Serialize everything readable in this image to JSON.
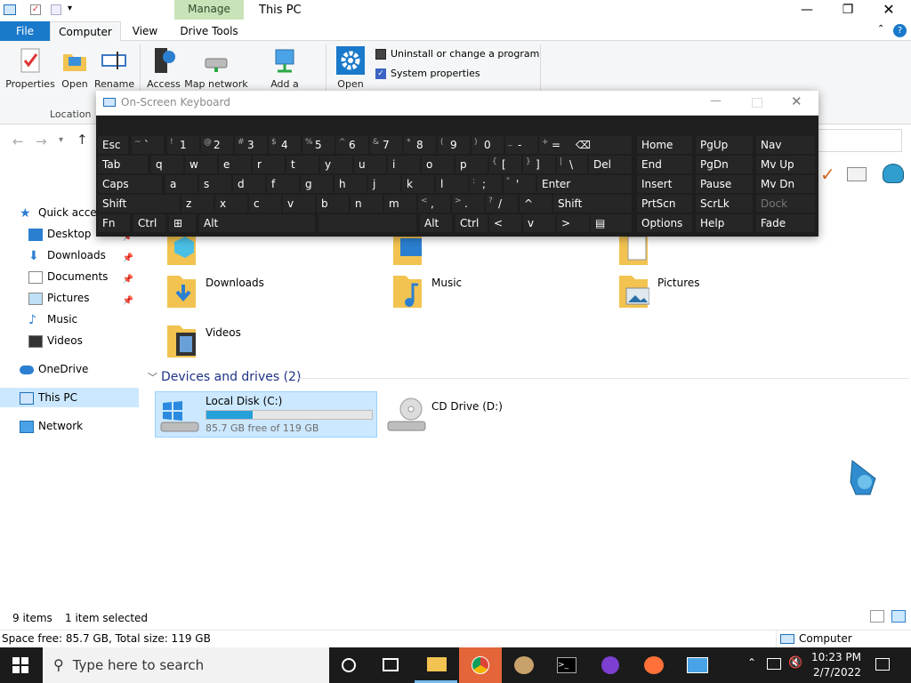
{
  "window": {
    "title": "This PC",
    "manage_tab": "Manage"
  },
  "ribbon_tabs": {
    "file": "File",
    "computer": "Computer",
    "view": "View",
    "drive_tools": "Drive Tools"
  },
  "ribbon": {
    "properties": "Properties",
    "open": "Open",
    "rename": "Rename",
    "access": "Access",
    "map_network": "Map network",
    "add_network": "Add a network",
    "open2": "Open",
    "uninstall": "Uninstall or change a program",
    "system_properties": "System properties",
    "location_group": "Location"
  },
  "osk": {
    "title": "On-Screen Keyboard",
    "row1": [
      {
        "sub": "",
        "main": "Esc"
      },
      {
        "sub": "~",
        "main": "`"
      },
      {
        "sub": "!",
        "main": "1"
      },
      {
        "sub": "@",
        "main": "2"
      },
      {
        "sub": "#",
        "main": "3"
      },
      {
        "sub": "$",
        "main": "4"
      },
      {
        "sub": "%",
        "main": "5"
      },
      {
        "sub": "^",
        "main": "6"
      },
      {
        "sub": "&",
        "main": "7"
      },
      {
        "sub": "*",
        "main": "8"
      },
      {
        "sub": "(",
        "main": "9"
      },
      {
        "sub": ")",
        "main": "0"
      },
      {
        "sub": "_",
        "main": "-"
      },
      {
        "sub": "+",
        "main": "="
      },
      {
        "sub": "",
        "main": "⌫"
      }
    ],
    "row2": [
      {
        "sub": "",
        "main": "Tab"
      },
      {
        "sub": "",
        "main": "q"
      },
      {
        "sub": "",
        "main": "w"
      },
      {
        "sub": "",
        "main": "e"
      },
      {
        "sub": "",
        "main": "r"
      },
      {
        "sub": "",
        "main": "t"
      },
      {
        "sub": "",
        "main": "y"
      },
      {
        "sub": "",
        "main": "u"
      },
      {
        "sub": "",
        "main": "i"
      },
      {
        "sub": "",
        "main": "o"
      },
      {
        "sub": "",
        "main": "p"
      },
      {
        "sub": "{",
        "main": "["
      },
      {
        "sub": "}",
        "main": "]"
      },
      {
        "sub": "|",
        "main": "\\"
      },
      {
        "sub": "",
        "main": "Del"
      }
    ],
    "row3": [
      {
        "sub": "",
        "main": "Caps"
      },
      {
        "sub": "",
        "main": "a"
      },
      {
        "sub": "",
        "main": "s"
      },
      {
        "sub": "",
        "main": "d"
      },
      {
        "sub": "",
        "main": "f"
      },
      {
        "sub": "",
        "main": "g"
      },
      {
        "sub": "",
        "main": "h"
      },
      {
        "sub": "",
        "main": "j"
      },
      {
        "sub": "",
        "main": "k"
      },
      {
        "sub": "",
        "main": "l"
      },
      {
        "sub": ":",
        "main": ";"
      },
      {
        "sub": "\"",
        "main": "'"
      },
      {
        "sub": "",
        "main": "Enter"
      }
    ],
    "row4": [
      {
        "sub": "",
        "main": "Shift"
      },
      {
        "sub": "",
        "main": "z"
      },
      {
        "sub": "",
        "main": "x"
      },
      {
        "sub": "",
        "main": "c"
      },
      {
        "sub": "",
        "main": "v"
      },
      {
        "sub": "",
        "main": "b"
      },
      {
        "sub": "",
        "main": "n"
      },
      {
        "sub": "",
        "main": "m"
      },
      {
        "sub": "<",
        "main": ","
      },
      {
        "sub": ">",
        "main": "."
      },
      {
        "sub": "?",
        "main": "/"
      },
      {
        "sub": "",
        "main": "^"
      },
      {
        "sub": "",
        "main": "Shift"
      }
    ],
    "row5": [
      {
        "sub": "",
        "main": "Fn"
      },
      {
        "sub": "",
        "main": "Ctrl"
      },
      {
        "sub": "",
        "main": "⊞"
      },
      {
        "sub": "",
        "main": "Alt"
      },
      {
        "sub": "",
        "main": ""
      },
      {
        "sub": "",
        "main": "Alt"
      },
      {
        "sub": "",
        "main": "Ctrl"
      },
      {
        "sub": "",
        "main": "<"
      },
      {
        "sub": "",
        "main": "v"
      },
      {
        "sub": "",
        "main": ">"
      },
      {
        "sub": "",
        "main": "▤"
      }
    ],
    "right": [
      [
        "Home",
        "PgUp",
        "Nav"
      ],
      [
        "End",
        "PgDn",
        "Mv Up"
      ],
      [
        "Insert",
        "Pause",
        "Mv Dn"
      ],
      [
        "PrtScn",
        "ScrLk",
        "Dock"
      ],
      [
        "Options",
        "Help",
        "Fade"
      ]
    ]
  },
  "nav": {
    "quick_access": "Quick access",
    "desktop": "Desktop",
    "downloads": "Downloads",
    "documents": "Documents",
    "pictures": "Pictures",
    "music": "Music",
    "videos": "Videos",
    "onedrive": "OneDrive",
    "this_pc": "This PC",
    "network": "Network"
  },
  "folders": {
    "downloads": "Downloads",
    "music": "Music",
    "pictures": "Pictures",
    "videos": "Videos"
  },
  "devices": {
    "header": "Devices and drives (2)",
    "local_disk": {
      "name": "Local Disk (C:)",
      "free": "85.7 GB free of 119 GB",
      "used_fraction": 0.28
    },
    "cd_drive": {
      "name": "CD Drive (D:)"
    }
  },
  "status": {
    "items": "9 items",
    "selected": "1 item selected"
  },
  "details": {
    "space": "Space free: 85.7 GB, Total size: 119 GB",
    "location": "Computer"
  },
  "taskbar": {
    "search_placeholder": "Type here to search",
    "time": "10:23 PM",
    "date": "2/7/2022"
  }
}
